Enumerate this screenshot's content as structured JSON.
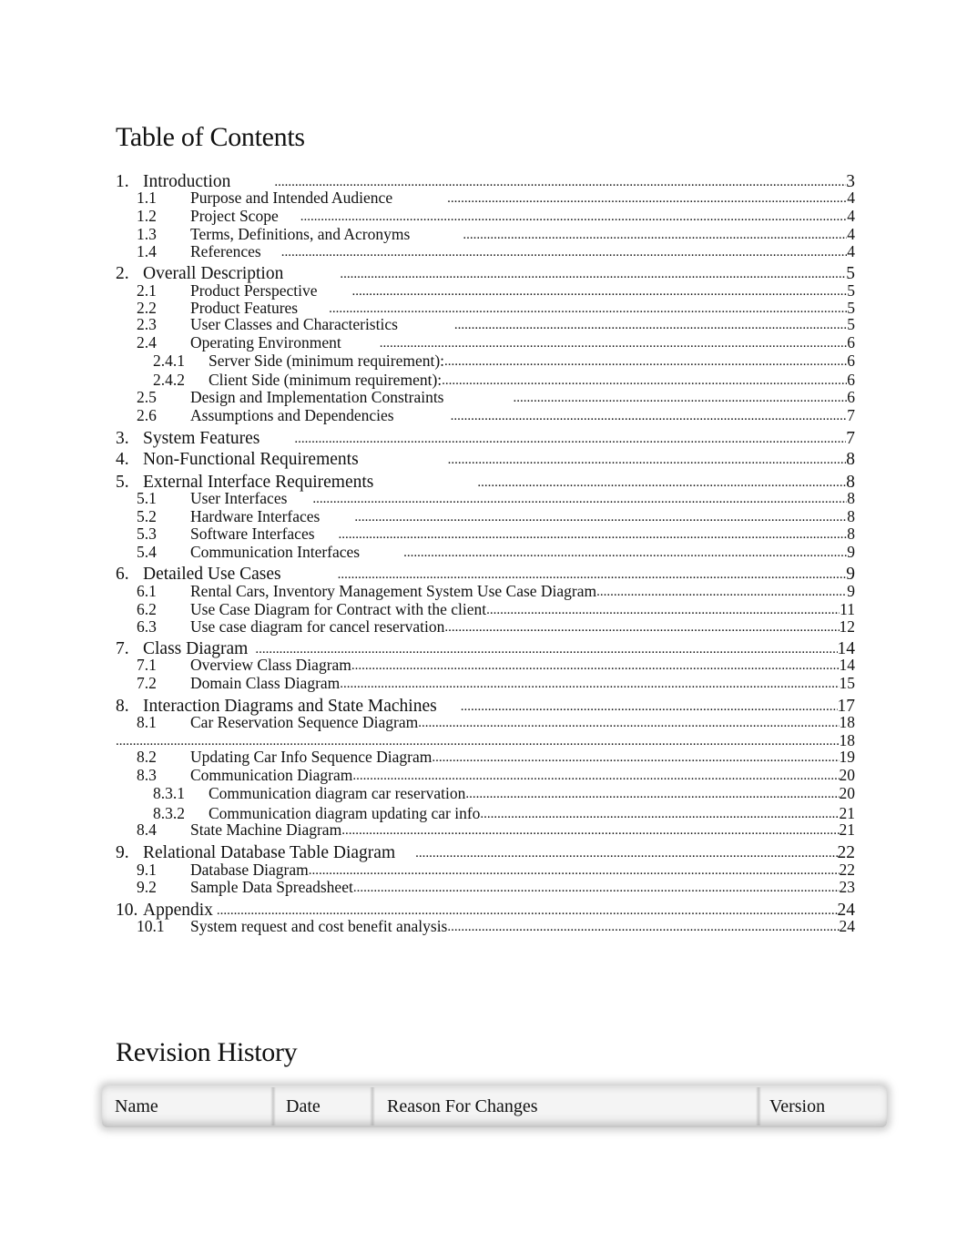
{
  "toc": {
    "title": "Table of Contents",
    "entries": [
      {
        "level": 1,
        "num": "1.",
        "title": "Introduction",
        "page": "3",
        "gap": 48
      },
      {
        "level": 2,
        "num": "1.1",
        "title": "Purpose and Intended Audience",
        "page": "4",
        "gap": 60
      },
      {
        "level": 2,
        "num": "1.2",
        "title": "Project Scope",
        "page": "4",
        "gap": 24
      },
      {
        "level": 2,
        "num": "1.3",
        "title": "Terms, Definitions, and Acronyms",
        "page": "4",
        "gap": 58
      },
      {
        "level": 2,
        "num": "1.4",
        "title": "References",
        "page": "4",
        "gap": 22
      },
      {
        "level": 1,
        "num": "2.",
        "title": "Overall Description",
        "page": "5",
        "gap": 62
      },
      {
        "level": 2,
        "num": "2.1",
        "title": "Product Perspective",
        "page": "5",
        "gap": 38
      },
      {
        "level": 2,
        "num": "2.2",
        "title": "Product Features",
        "page": "5",
        "gap": 34
      },
      {
        "level": 2,
        "num": "2.3",
        "title": "User Classes and Characteristics",
        "page": "5",
        "gap": 62
      },
      {
        "level": 2,
        "num": "2.4",
        "title": "Operating Environment",
        "page": "6",
        "gap": 42
      },
      {
        "level": 3,
        "num": "2.4.1",
        "title": "Server Side (minimum requirement):",
        "page": "6",
        "gap": 0
      },
      {
        "level": 3,
        "num": "2.4.2",
        "title": "Client Side (minimum requirement):",
        "page": "6",
        "gap": 0
      },
      {
        "level": 2,
        "num": "2.5",
        "title": "Design and Implementation Constraints",
        "page": "6",
        "gap": 76
      },
      {
        "level": 2,
        "num": "2.6",
        "title": "Assumptions and Dependencies",
        "page": "7",
        "gap": 62
      },
      {
        "level": 1,
        "num": "3.",
        "title": "System Features",
        "page": "7",
        "gap": 38
      },
      {
        "level": 1,
        "num": "4.",
        "title": "Non-Functional Requirements",
        "page": "8",
        "gap": 98
      },
      {
        "level": 1,
        "num": "5.",
        "title": "External Interface Requirements",
        "page": "8",
        "gap": 114
      },
      {
        "level": 2,
        "num": "5.1",
        "title": "User Interfaces",
        "page": "8",
        "gap": 28
      },
      {
        "level": 2,
        "num": "5.2",
        "title": "Hardware Interfaces",
        "page": "8",
        "gap": 38
      },
      {
        "level": 2,
        "num": "5.3",
        "title": "Software Interfaces",
        "page": "8",
        "gap": 26
      },
      {
        "level": 2,
        "num": "5.4",
        "title": "Communication Interfaces",
        "page": "9",
        "gap": 48
      },
      {
        "level": 1,
        "num": "6.",
        "title": "Detailed Use Cases",
        "page": "9",
        "gap": 62
      },
      {
        "level": 2,
        "num": "6.1",
        "title": "Rental Cars, Inventory Management System Use Case Diagram",
        "page": "9",
        "gap": 0
      },
      {
        "level": 2,
        "num": "6.2",
        "title": "Use Case Diagram for Contract with the client",
        "page": "11",
        "gap": 0
      },
      {
        "level": 2,
        "num": "6.3",
        "title": "Use case diagram for cancel reservation",
        "page": "12",
        "gap": 0
      },
      {
        "level": 1,
        "num": "7.",
        "title": "Class Diagram",
        "page": "14",
        "gap": 8
      },
      {
        "level": 2,
        "num": "7.1",
        "title": "Overview Class Diagram",
        "page": "14",
        "gap": 0
      },
      {
        "level": 2,
        "num": "7.2",
        "title": "Domain Class Diagram",
        "page": "15",
        "gap": 0
      },
      {
        "level": 1,
        "num": "8.",
        "title": "Interaction Diagrams and State Machines",
        "page": "17",
        "gap": 26
      },
      {
        "level": 2,
        "num": "8.1",
        "title": "Car Reservation Sequence Diagram",
        "page": "18",
        "gap": 0
      },
      {
        "level": 0,
        "num": "",
        "title": "",
        "page": "18",
        "gap": 0
      },
      {
        "level": 2,
        "num": "8.2",
        "title": "Updating Car Info Sequence Diagram",
        "page": "19",
        "gap": 0
      },
      {
        "level": 2,
        "num": "8.3",
        "title": "Communication Diagram",
        "page": "20",
        "gap": 0
      },
      {
        "level": 3,
        "num": "8.3.1",
        "title": "Communication diagram car reservation",
        "page": "20",
        "gap": 0
      },
      {
        "level": 3,
        "num": "8.3.2",
        "title": "Communication diagram updating car info",
        "page": "21",
        "gap": 0
      },
      {
        "level": 2,
        "num": "8.4",
        "title": "State Machine Diagram",
        "page": "21",
        "gap": 0
      },
      {
        "level": 1,
        "num": "9.",
        "title": "Relational Database Table Diagram",
        "page": "22",
        "gap": 22
      },
      {
        "level": 2,
        "num": "9.1",
        "title": "Database Diagram",
        "page": "22",
        "gap": 0
      },
      {
        "level": 2,
        "num": "9.2",
        "title": "Sample Data Spreadsheet",
        "page": "23",
        "gap": 0
      },
      {
        "level": 1,
        "num": "10.",
        "title": "Appendix",
        "page": "24",
        "gap": 4
      },
      {
        "level": 2,
        "num": "10.1",
        "title": "System request and cost benefit analysis",
        "page": "24",
        "gap": 0
      }
    ]
  },
  "revision_history": {
    "title": "Revision History",
    "columns": [
      "Name",
      "Date",
      "Reason For Changes",
      "Version"
    ]
  }
}
